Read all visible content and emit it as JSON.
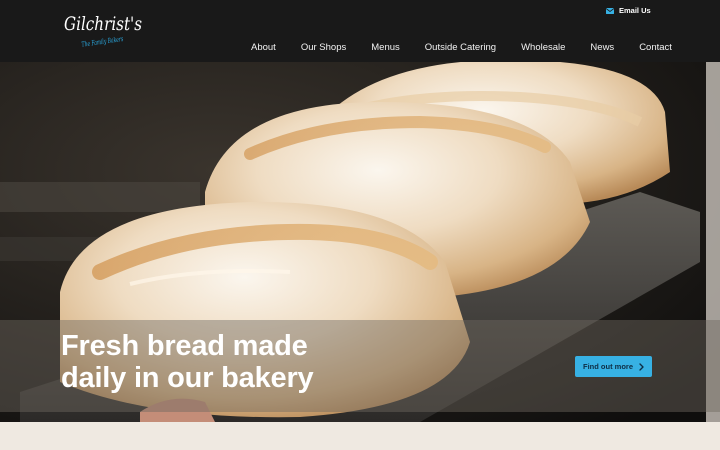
{
  "brand": {
    "logo_name": "Gilchrist's",
    "logo_tagline": "The Family Bakers"
  },
  "header": {
    "email_label": "Email Us",
    "email_icon": "envelope-icon"
  },
  "nav": {
    "items": [
      "About",
      "Our Shops",
      "Menus",
      "Outside Catering",
      "Wholesale",
      "News",
      "Contact"
    ]
  },
  "hero": {
    "title_line1": "Fresh bread made",
    "title_line2": "daily in our bakery",
    "cta_label": "Find out more",
    "cta_icon": "chevron-right-icon"
  },
  "colors": {
    "header_bg": "#191919",
    "accent": "#37b1e4",
    "logo_blue": "#2aa8df",
    "footer_bg": "#efe9e1"
  }
}
